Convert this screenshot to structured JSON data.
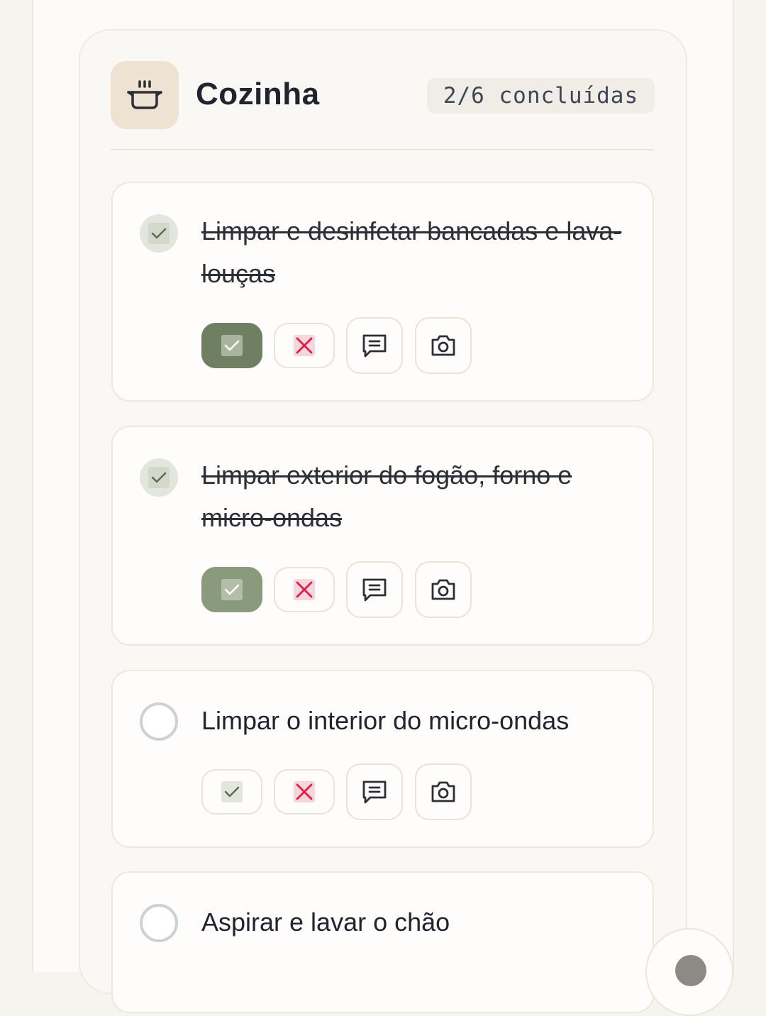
{
  "section": {
    "icon": "cooking-pot-icon",
    "title": "Cozinha",
    "progress": "2/6 concluídas",
    "completed": 2,
    "total": 6
  },
  "tasks": [
    {
      "title": "Limpar e desinfetar bancadas e lava-louças",
      "done": true
    },
    {
      "title": "Limpar exterior do fogão, forno e micro-ondas",
      "done": true
    },
    {
      "title": "Limpar o interior do micro-ondas",
      "done": false
    },
    {
      "title": "Aspirar e lavar o chão",
      "done": false
    }
  ],
  "actions": {
    "approve_icon": "check-icon",
    "reject_icon": "x-icon",
    "comment_icon": "comment-icon",
    "photo_icon": "camera-icon"
  },
  "colors": {
    "accent_green": "#6f7f62",
    "reject_red": "#e11d48",
    "pending_border": "#ccd1d6"
  }
}
